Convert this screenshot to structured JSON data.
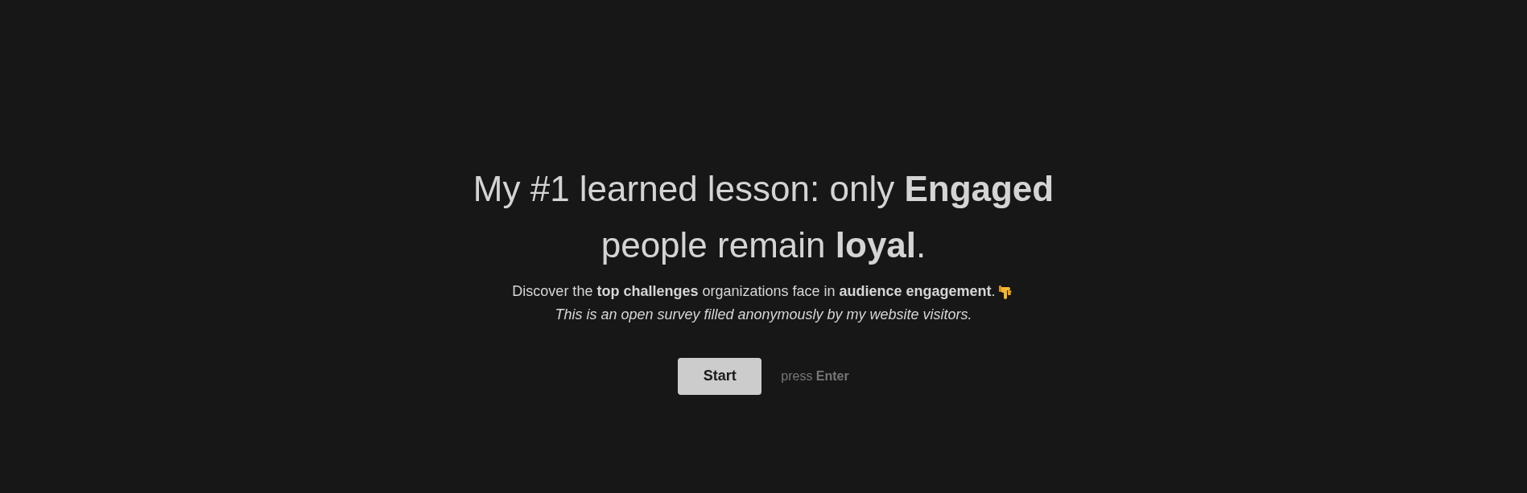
{
  "headline": "My #1 learned lesson: only **Engaged** people remain **loyal**.",
  "description": "Discover the **top challenges** organizations face in **audience engagement**.",
  "note": "This is an open survey filled anonymously by my website visitors.",
  "start_button": "Start",
  "hint": "press **Enter**"
}
